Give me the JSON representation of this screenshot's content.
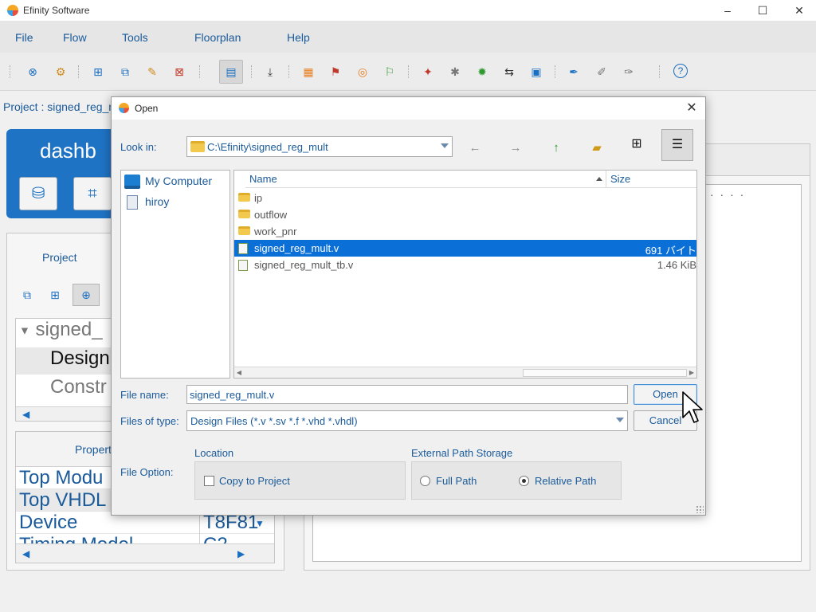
{
  "app": {
    "title": "Efinity Software",
    "window_controls": {
      "minimize": "–",
      "maximize": "☐",
      "close": "✕"
    }
  },
  "menu": {
    "items": [
      "File",
      "Flow",
      "Tools",
      "Floorplan",
      "Help"
    ]
  },
  "toolbar": {
    "icons": [
      "stop-icon",
      "settings-gear-icon",
      "new-project-icon",
      "open-project-icon",
      "edit-project-icon",
      "close-project-icon",
      "console-icon",
      "import-icon",
      "grid-icon",
      "report-icon",
      "route-icon",
      "export-icon",
      "debug-icon",
      "bug-icon",
      "green-bug-icon",
      "connect-icon",
      "ip-icon",
      "pen-icon",
      "pen-outline-icon",
      "pen-check-icon",
      "help-icon"
    ],
    "help_glyph": "?"
  },
  "project_line": "Project : signed_reg_m",
  "dashboard": {
    "title": "dashb"
  },
  "left_panel": {
    "tab_label": "Project",
    "tree": {
      "root": "signed_",
      "items": [
        "Design",
        "Constr"
      ]
    },
    "properties_label": "Propert",
    "properties": [
      {
        "key": "Top Modu",
        "value": ""
      },
      {
        "key": "Top VHDL",
        "value": ""
      },
      {
        "key": "Device",
        "value": "T8F81"
      },
      {
        "key": "Timing Model",
        "value": "C2"
      }
    ]
  },
  "right_panel": {
    "dots": "· · · ·"
  },
  "dialog": {
    "title": "Open",
    "close_glyph": "✕",
    "look_in_label": "Look in:",
    "look_in_value": "C:\\Efinity\\signed_reg_mult",
    "nav": {
      "back": "←",
      "forward": "→",
      "up": "↑"
    },
    "sidebar": [
      {
        "label": "My Computer",
        "icon": "computer-icon"
      },
      {
        "label": "hiroy",
        "icon": "user-folder-icon"
      }
    ],
    "columns": {
      "name": "Name",
      "size": "Size"
    },
    "files": [
      {
        "name": "ip",
        "size": "",
        "type": "folder",
        "selected": false
      },
      {
        "name": "outflow",
        "size": "",
        "type": "folder",
        "selected": false
      },
      {
        "name": "work_pnr",
        "size": "",
        "type": "folder",
        "selected": false
      },
      {
        "name": "signed_reg_mult.v",
        "size": "691 バイト",
        "type": "verilog",
        "selected": true
      },
      {
        "name": "signed_reg_mult_tb.v",
        "size": "1.46 KiB",
        "type": "verilog",
        "selected": false
      }
    ],
    "file_name_label": "File name:",
    "file_name_value": "signed_reg_mult.v",
    "files_of_type_label": "Files of type:",
    "files_of_type_value": "Design Files (*.v *.sv *.f *.vhd *.vhdl)",
    "open_button": "Open",
    "cancel_button": "Cancel",
    "file_option_label": "File Option:",
    "location_label": "Location",
    "copy_to_project_label": "Copy to Project",
    "copy_to_project_checked": false,
    "external_path_label": "External Path Storage",
    "full_path_label": "Full Path",
    "relative_path_label": "Relative Path",
    "selected_path_mode": "Relative Path"
  },
  "colors": {
    "accent": "#1a5a9a",
    "selection": "#0a6fd6",
    "dashboard": "#1f73c4"
  }
}
